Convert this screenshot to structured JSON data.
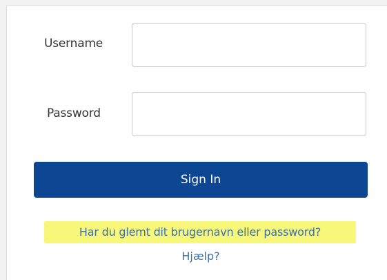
{
  "form": {
    "username_label": "Username",
    "username_value": "",
    "password_label": "Password",
    "password_value": "",
    "signin_label": "Sign In",
    "forgot_label": "Har du glemt dit brugernavn eller password?",
    "help_label": "Hjælp?"
  },
  "colors": {
    "button_bg": "#0d4793",
    "link": "#3e6fa8",
    "highlight": "#f7f77a"
  }
}
